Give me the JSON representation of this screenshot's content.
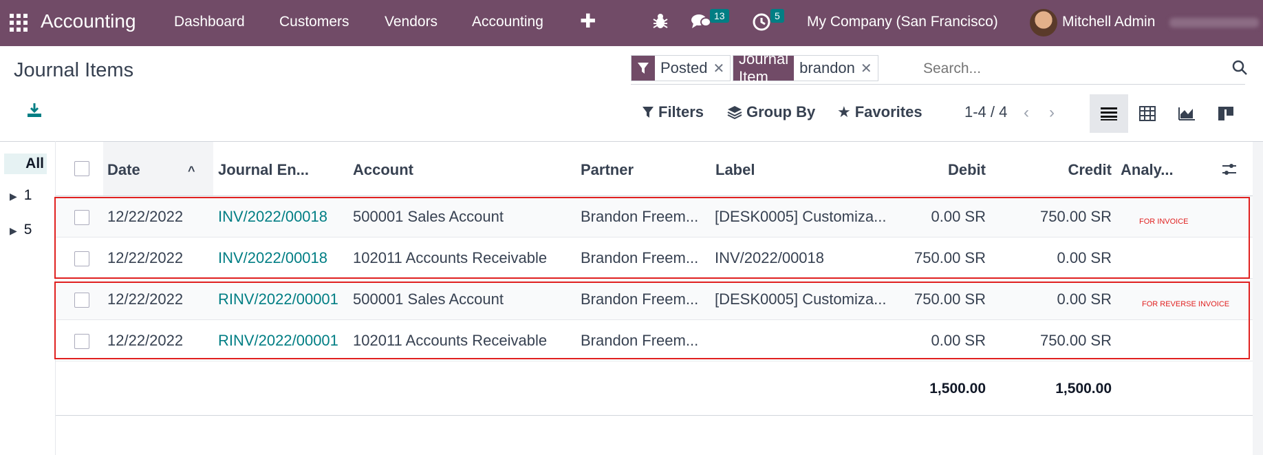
{
  "nav": {
    "app_name": "Accounting",
    "menu": [
      "Dashboard",
      "Customers",
      "Vendors",
      "Accounting"
    ],
    "messages_count": "13",
    "activities_count": "5",
    "company": "My Company (San Francisco)",
    "user": "Mitchell Admin"
  },
  "page": {
    "title": "Journal Items"
  },
  "search": {
    "facets": [
      {
        "label": "",
        "value": "Posted",
        "icon": "filter-icon"
      },
      {
        "label": "Journal Item",
        "value": "brandon"
      }
    ],
    "placeholder": "Search..."
  },
  "controls": {
    "filters": "Filters",
    "group_by": "Group By",
    "favorites": "Favorites",
    "pager": "1-4 / 4"
  },
  "sidepanel": {
    "all": "All",
    "items": [
      "1",
      "5"
    ]
  },
  "table": {
    "columns": [
      "Date",
      "Journal En...",
      "Account",
      "Partner",
      "Label",
      "Debit",
      "Credit",
      "Analy..."
    ],
    "rows": [
      {
        "date": "12/22/2022",
        "entry": "INV/2022/00018",
        "account": "500001 Sales Account",
        "partner": "Brandon Freem...",
        "label": "[DESK0005] Customiza...",
        "debit": "0.00 SR",
        "credit": "750.00 SR"
      },
      {
        "date": "12/22/2022",
        "entry": "INV/2022/00018",
        "account": "102011 Accounts Receivable",
        "partner": "Brandon Freem...",
        "label": "INV/2022/00018",
        "debit": "750.00 SR",
        "credit": "0.00 SR"
      },
      {
        "date": "12/22/2022",
        "entry": "RINV/2022/00001",
        "account": "500001 Sales Account",
        "partner": "Brandon Freem...",
        "label": "[DESK0005] Customiza...",
        "debit": "750.00 SR",
        "credit": "0.00 SR"
      },
      {
        "date": "12/22/2022",
        "entry": "RINV/2022/00001",
        "account": "102011 Accounts Receivable",
        "partner": "Brandon Freem...",
        "label": "",
        "debit": "0.00 SR",
        "credit": "750.00 SR"
      }
    ],
    "totals": {
      "debit": "1,500.00",
      "credit": "1,500.00"
    }
  },
  "annotations": {
    "invoice": "FOR INVOICE",
    "reverse_invoice": "FOR REVERSE INVOICE"
  },
  "colors": {
    "brand": "#714B67",
    "link": "#017E84",
    "highlight_box": "#e0201f"
  }
}
